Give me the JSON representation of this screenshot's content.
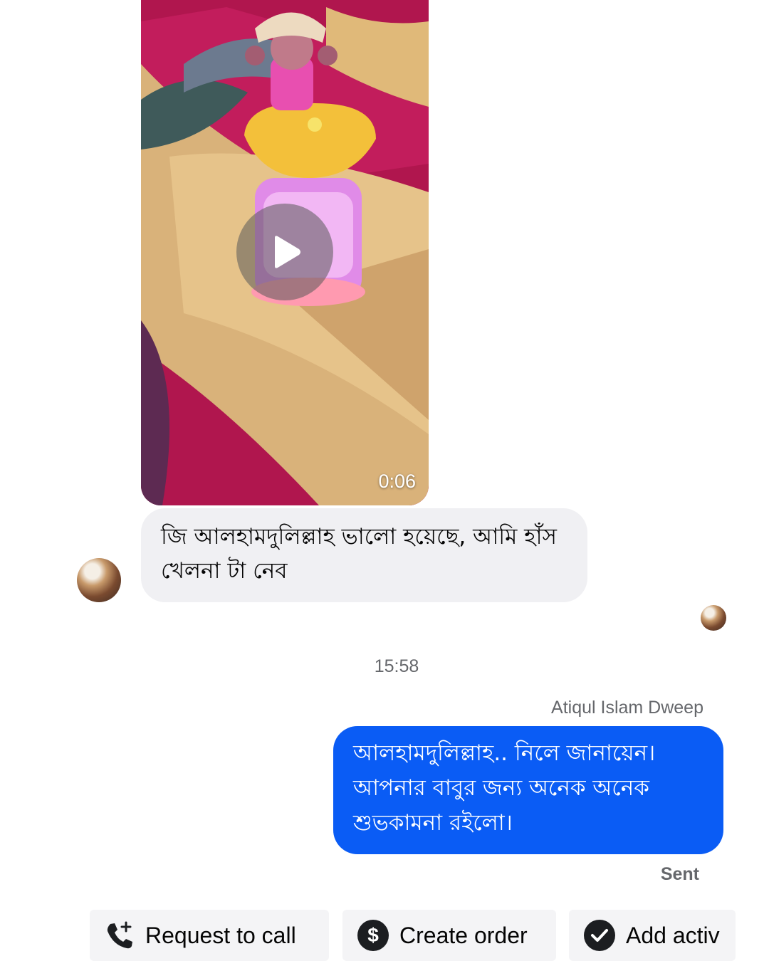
{
  "video": {
    "duration": "0:06",
    "icon": "play-icon"
  },
  "incoming_message": {
    "text": "জি আলহামদুলিল্লাহ ভালো হয়েছে, আমি হাঁস খেলনা টা নেব"
  },
  "timestamp": "15:58",
  "sender_name": "Atiqul Islam Dweep",
  "outgoing_message": {
    "text": "আলহামদুলিল্লাহ..  নিলে জানায়েন। আপনার বাবুর জন্য অনেক অনেক শুভকামনা রইলো।"
  },
  "status": "Sent",
  "quick_actions": [
    {
      "label": "Request to call",
      "icon": "phone-plus-icon"
    },
    {
      "label": "Create order",
      "icon": "dollar-icon"
    },
    {
      "label": "Add activ",
      "icon": "checkmark-icon"
    }
  ],
  "colors": {
    "outgoing_bubble": "#0a5cf5",
    "incoming_bubble": "#f0f0f3",
    "meta_text": "#65676b"
  }
}
